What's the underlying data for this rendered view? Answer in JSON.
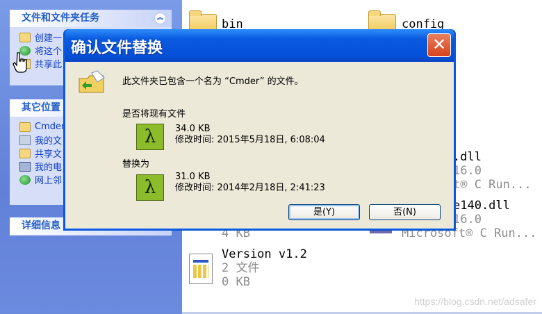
{
  "taskpane": {
    "file_tasks": {
      "title": "文件和文件夹任务",
      "items": [
        {
          "label": "创建一",
          "icon": "new-folder-icon"
        },
        {
          "label": "将这个",
          "icon": "publish-web-icon"
        },
        {
          "label": "共享此",
          "icon": "share-folder-icon"
        }
      ]
    },
    "other_places": {
      "title": "其它位置",
      "items": [
        {
          "label": "Cmder",
          "icon": "folder-icon"
        },
        {
          "label": "我的文",
          "icon": "my-documents-icon"
        },
        {
          "label": "共享文",
          "icon": "shared-documents-icon"
        },
        {
          "label": "我的电",
          "icon": "my-computer-icon"
        },
        {
          "label": "网上邻",
          "icon": "network-icon"
        }
      ]
    },
    "details": {
      "title": "详细信息"
    }
  },
  "files": {
    "bin": {
      "name": "bin"
    },
    "config": {
      "name": "config"
    },
    "dll1": {
      "name": ".dll",
      "line2": "16.0",
      "line3": "t® C Run..."
    },
    "dll2": {
      "name": "e140.dll",
      "line2": "16.0",
      "line3": "Microsoft® C Run..."
    },
    "partial": {
      "line3": "4 KB"
    },
    "version": {
      "name": "Version v1.2",
      "line2": "2 文件",
      "line3": "0 KB"
    }
  },
  "watermark": "https://blog.csdn.net/adsafer",
  "dialog": {
    "title": "确认文件替换",
    "message": "此文件夹已包含一个名为 “Cmder” 的文件。",
    "replace_question": "是否将现有文件",
    "existing": {
      "size": "34.0 KB",
      "modified": "修改时间: 2015年5月18日, 6:08:04"
    },
    "with_label": "替换为",
    "new": {
      "size": "31.0 KB",
      "modified": "修改时间: 2014年2月18日, 2:41:23"
    },
    "yes_label": "是(Y)",
    "no_label": "否(N)",
    "close_glyph": "✕"
  },
  "colors": {
    "title_bar": "#0a58e0",
    "close": "#d6421c",
    "pane_text": "#215dc6",
    "lambda": "#8cbb2b"
  }
}
